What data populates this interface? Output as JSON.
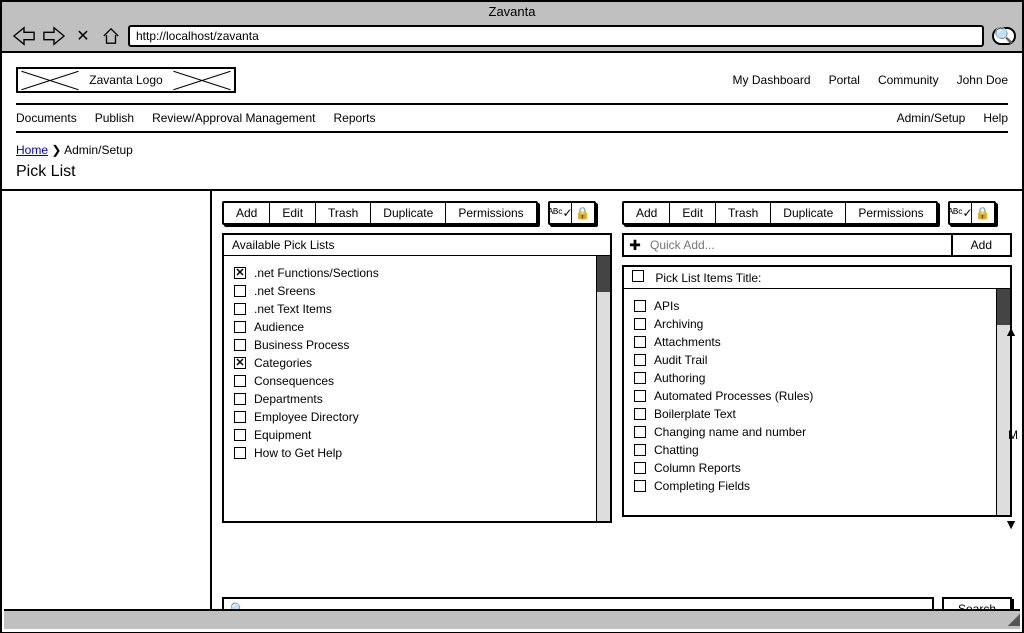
{
  "window": {
    "title": "Zavanta",
    "url": "http://localhost/zavanta"
  },
  "logo_text": "Zavanta Logo",
  "topnav": [
    "My Dashboard",
    "Portal",
    "Community",
    "John Doe"
  ],
  "menubar_left": [
    "Documents",
    "Publish",
    "Review/Approval Management",
    "Reports"
  ],
  "menubar_right": [
    "Admin/Setup",
    "Help"
  ],
  "breadcrumb": {
    "home": "Home",
    "sep": "❯",
    "current": "Admin/Setup"
  },
  "page_title": "Pick List",
  "toolbar_buttons": {
    "add": "Add",
    "edit": "Edit",
    "trash": "Trash",
    "duplicate": "Duplicate",
    "permissions": "Permissions"
  },
  "left_panel": {
    "header": "Available Pick Lists",
    "items": [
      {
        "label": ".net Functions/Sections",
        "checked": true
      },
      {
        "label": ".net Sreens",
        "checked": false
      },
      {
        "label": ".net Text Items",
        "checked": false
      },
      {
        "label": "Audience",
        "checked": false
      },
      {
        "label": "Business Process",
        "checked": false
      },
      {
        "label": "Categories",
        "checked": true
      },
      {
        "label": "Consequences",
        "checked": false
      },
      {
        "label": "Departments",
        "checked": false
      },
      {
        "label": "Employee Directory",
        "checked": false
      },
      {
        "label": "Equipment",
        "checked": false
      },
      {
        "label": "How to Get Help",
        "checked": false
      }
    ]
  },
  "right_panel": {
    "quick_add_placeholder": "Quick Add...",
    "quick_add_button": "Add",
    "header": "Pick List Items Title:",
    "items": [
      {
        "label": "APIs",
        "checked": false
      },
      {
        "label": "Archiving",
        "checked": false
      },
      {
        "label": "Attachments",
        "checked": false
      },
      {
        "label": "Audit Trail",
        "checked": false
      },
      {
        "label": "Authoring",
        "checked": false
      },
      {
        "label": "Automated Processes (Rules)",
        "checked": false
      },
      {
        "label": "Boilerplate Text",
        "checked": false
      },
      {
        "label": "Changing name and number",
        "checked": false
      },
      {
        "label": "Chatting",
        "checked": false
      },
      {
        "label": "Column Reports",
        "checked": false
      },
      {
        "label": "Completing Fields",
        "checked": false
      }
    ]
  },
  "search": {
    "button": "Search"
  },
  "icons": {
    "spellcheck": "ᴬᴮᶜ✓",
    "lock": "🔒",
    "search": "🔍",
    "plus": "✚"
  }
}
